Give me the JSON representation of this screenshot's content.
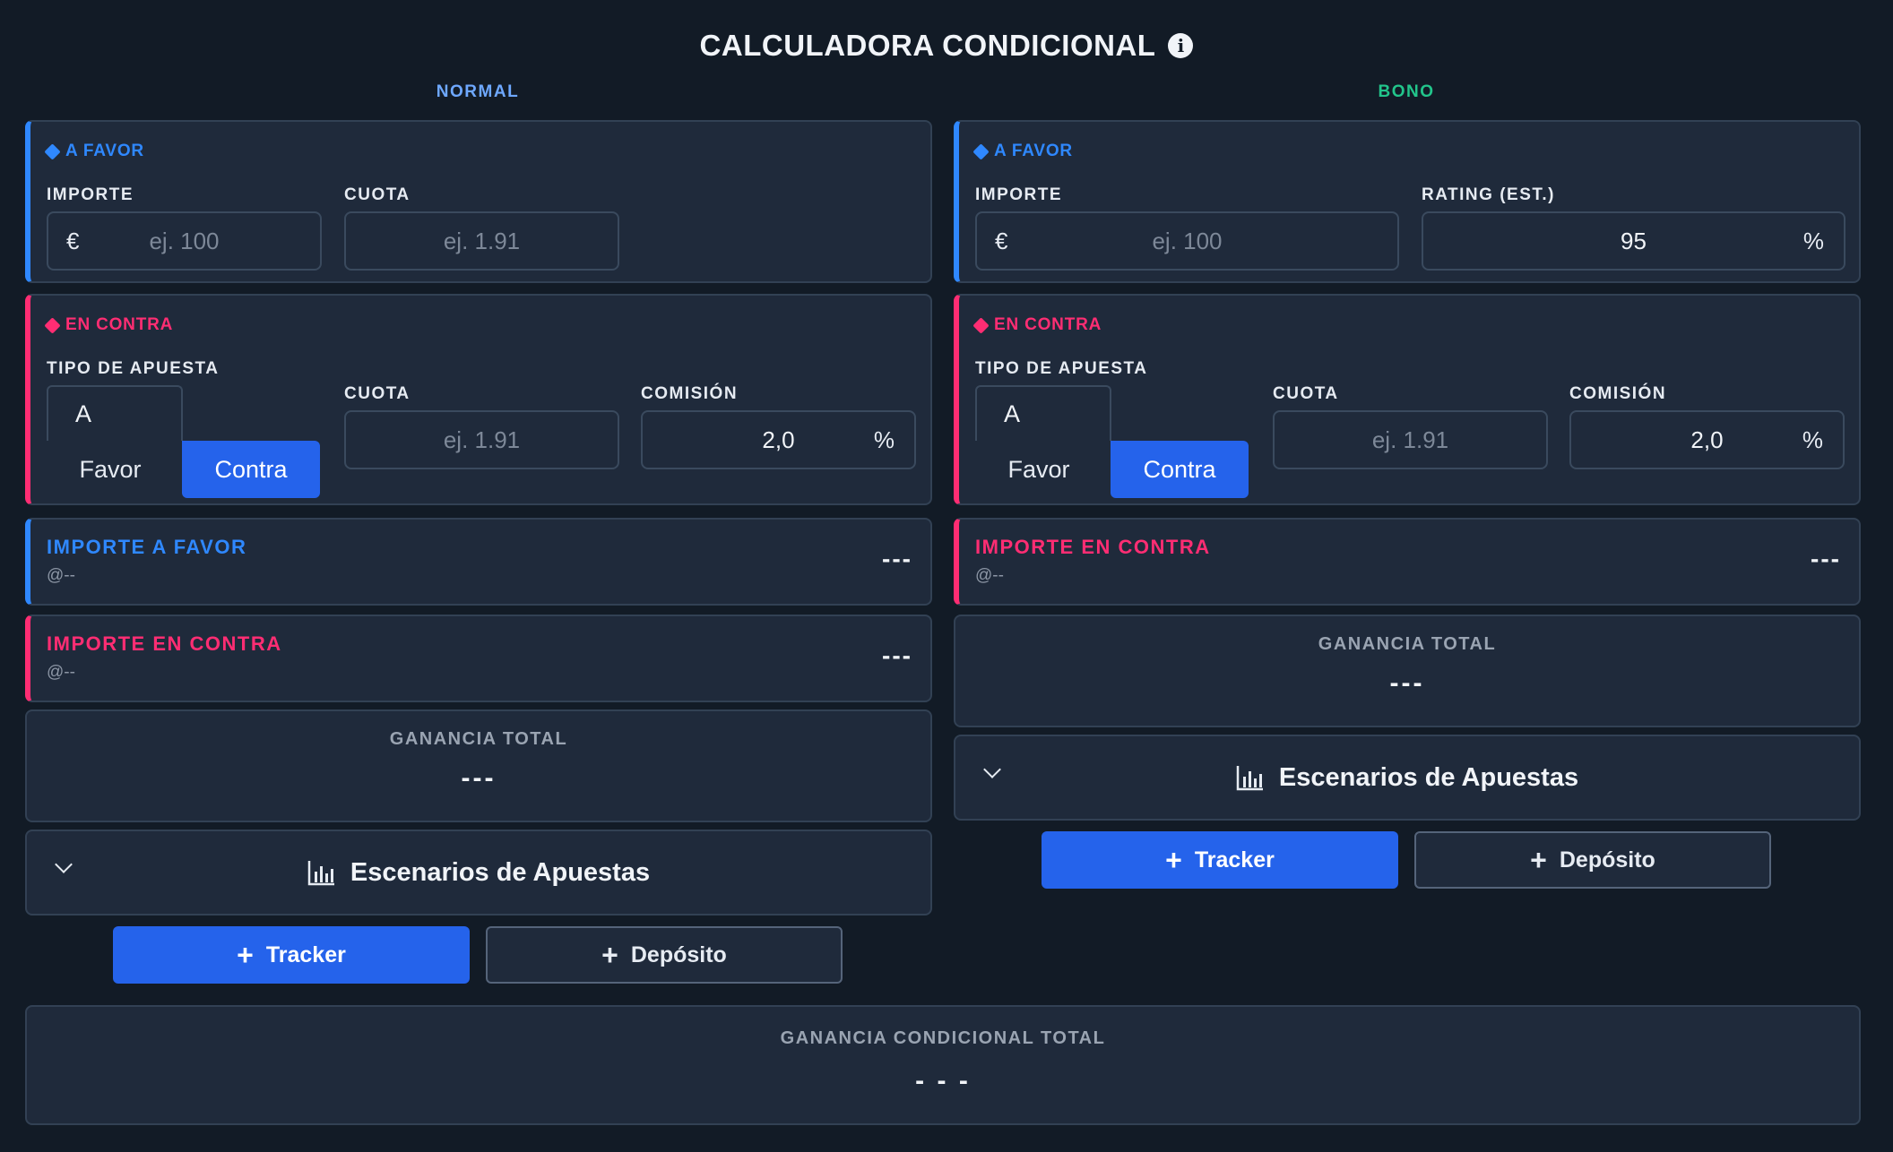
{
  "title": "CALCULADORA CONDICIONAL",
  "colors": {
    "background": "#121b26",
    "card": "#1f2a3b",
    "blue": "#2f88ff",
    "pink": "#ff2d73",
    "green": "#22c58b",
    "primary": "#2563eb",
    "normal_label": "#6ea8ff"
  },
  "normal": {
    "label": "NORMAL",
    "favor": {
      "heading": "A FAVOR",
      "importe_label": "IMPORTE",
      "importe_prefix": "€",
      "importe_placeholder": "ej. 100",
      "cuota_label": "CUOTA",
      "cuota_placeholder": "ej. 1.91"
    },
    "contra": {
      "heading": "EN CONTRA",
      "tipo_label": "TIPO DE APUESTA",
      "tipo_a": "A",
      "tipo_favor": "Favor",
      "tipo_contra": "Contra",
      "tipo_selected": "Contra",
      "cuota_label": "CUOTA",
      "cuota_placeholder": "ej. 1.91",
      "comision_label": "COMISIÓN",
      "comision_value": "2,0",
      "comision_suffix": "%"
    },
    "importe_favor": {
      "label": "IMPORTE A FAVOR",
      "sub": "@--",
      "value": "---"
    },
    "importe_contra": {
      "label": "IMPORTE EN CONTRA",
      "sub": "@--",
      "value": "---"
    },
    "ganancia": {
      "label": "GANANCIA TOTAL",
      "value": "---"
    },
    "scenarios": {
      "label": "Escenarios de Apuestas"
    },
    "tracker_label": "Tracker",
    "deposito_label": "Depósito"
  },
  "bono": {
    "label": "BONO",
    "favor": {
      "heading": "A FAVOR",
      "importe_label": "IMPORTE",
      "importe_prefix": "€",
      "importe_placeholder": "ej. 100",
      "rating_label": "RATING (EST.)",
      "rating_value": "95",
      "rating_suffix": "%"
    },
    "contra": {
      "heading": "EN CONTRA",
      "tipo_label": "TIPO DE APUESTA",
      "tipo_a": "A",
      "tipo_favor": "Favor",
      "tipo_contra": "Contra",
      "tipo_selected": "Contra",
      "cuota_label": "CUOTA",
      "cuota_placeholder": "ej. 1.91",
      "comision_label": "COMISIÓN",
      "comision_value": "2,0",
      "comision_suffix": "%"
    },
    "importe_contra": {
      "label": "IMPORTE EN CONTRA",
      "sub": "@--",
      "value": "---"
    },
    "ganancia": {
      "label": "GANANCIA TOTAL",
      "value": "---"
    },
    "scenarios": {
      "label": "Escenarios de Apuestas"
    },
    "tracker_label": "Tracker",
    "deposito_label": "Depósito"
  },
  "ganancia_condicional": {
    "label": "GANANCIA CONDICIONAL TOTAL",
    "value": "- - -"
  }
}
